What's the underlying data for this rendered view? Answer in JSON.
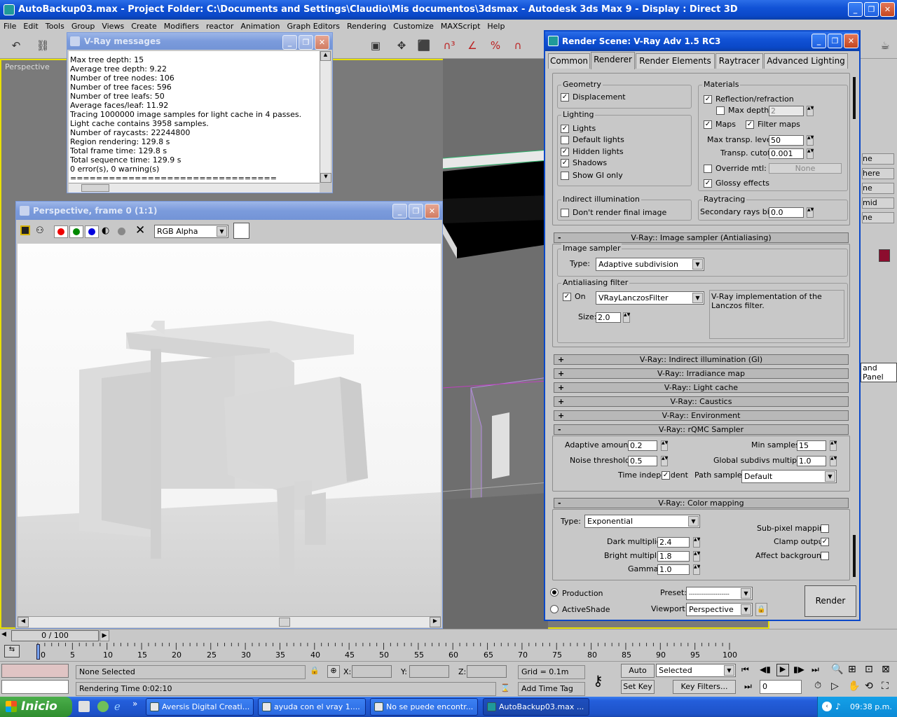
{
  "app": {
    "title": "AutoBackup03.max     - Project Folder: C:\\Documents and Settings\\Claudio\\Mis documentos\\3dsmax     - Autodesk 3ds Max 9     - Display : Direct 3D",
    "menu": [
      "File",
      "Edit",
      "Tools",
      "Group",
      "Views",
      "Create",
      "Modifiers",
      "reactor",
      "Animation",
      "Graph Editors",
      "Rendering",
      "Customize",
      "MAXScript",
      "Help"
    ],
    "viewport_label": "Perspective"
  },
  "vray_messages": {
    "title": "V-Ray messages",
    "lines": [
      "Max tree depth: 15",
      "Average tree depth: 9.22",
      "Number of tree nodes: 106",
      "Number of tree faces: 596",
      "Number of tree leafs: 50",
      "Average faces/leaf: 11.92",
      "Tracing 1000000 image samples for light cache in 4 passes.",
      "Light cache contains 3958 samples.",
      "Number of raycasts: 22244800",
      "Region rendering: 129.8 s",
      "Total frame time: 129.8 s",
      "Total sequence time: 129.9 s",
      "0 error(s), 0 warning(s)",
      "================================"
    ]
  },
  "frame_window": {
    "title": "Perspective, frame 0 (1:1)",
    "channel": "RGB Alpha"
  },
  "render_scene": {
    "title": "Render Scene: V-Ray Adv 1.5 RC3",
    "tabs": [
      "Common",
      "Renderer",
      "Render Elements",
      "Raytracer",
      "Advanced Lighting"
    ],
    "geometry": {
      "caption": "Geometry",
      "displacement": "Displacement"
    },
    "lighting": {
      "caption": "Lighting",
      "items": [
        "Lights",
        "Default lights",
        "Hidden lights",
        "Shadows",
        "Show GI only"
      ],
      "checked": [
        true,
        false,
        true,
        true,
        false
      ]
    },
    "indirect": {
      "caption": "Indirect illumination",
      "dont_render": "Don't render final image"
    },
    "materials": {
      "caption": "Materials",
      "reflection": "Reflection/refraction",
      "max_depth": "Max depth",
      "max_depth_val": "2",
      "maps": "Maps",
      "filter_maps": "Filter maps",
      "max_transp": "Max transp. levels",
      "max_transp_val": "50",
      "transp_cutoff": "Transp. cutoff",
      "transp_cutoff_val": "0.001",
      "override": "Override mtl:",
      "none": "None",
      "glossy": "Glossy effects"
    },
    "raytracing": {
      "caption": "Raytracing",
      "bias": "Secondary rays bias",
      "bias_val": "0.0"
    },
    "image_sampler_rollout": "V-Ray:: Image sampler (Antialiasing)",
    "image_sampler": {
      "caption": "Image sampler",
      "type_label": "Type:",
      "type": "Adaptive subdivision"
    },
    "aa_filter": {
      "caption": "Antialiasing filter",
      "on": "On",
      "filter": "VRayLanczosFilter",
      "desc": "V-Ray implementation of the Lanczos filter.",
      "size_label": "Size:",
      "size": "2.0"
    },
    "collapsed_rollouts": [
      "V-Ray:: Indirect illumination (GI)",
      "V-Ray:: Irradiance map",
      "V-Ray:: Light cache",
      "V-Ray:: Caustics",
      "V-Ray:: Environment"
    ],
    "rqmc_rollout": "V-Ray:: rQMC Sampler",
    "rqmc": {
      "adaptive_amount": "Adaptive amount:",
      "adaptive_amount_val": "0.2",
      "noise_threshold": "Noise threshold:",
      "noise_threshold_val": "0.5",
      "time_independent": "Time independent",
      "min_samples": "Min samples:",
      "min_samples_val": "15",
      "global_subdivs": "Global subdivs multiplier:",
      "global_subdivs_val": "1.0",
      "path_sampler": "Path sampler:",
      "path_sampler_val": "Default"
    },
    "color_mapping_rollout": "V-Ray:: Color mapping",
    "color_mapping": {
      "type_label": "Type:",
      "type": "Exponential",
      "dark": "Dark multiplier:",
      "dark_val": "2.4",
      "bright": "Bright multiplier:",
      "bright_val": "1.8",
      "gamma": "Gamma:",
      "gamma_val": "1.0",
      "subpixel": "Sub-pixel mapping",
      "clamp": "Clamp output",
      "affect_bg": "Affect background"
    },
    "production": "Production",
    "activeshade": "ActiveShade",
    "preset_label": "Preset:",
    "preset_val": "--------------------",
    "viewport_label": "Viewport:",
    "viewport_val": "Perspective",
    "render_btn": "Render"
  },
  "right_panel": {
    "items": [
      "ne",
      "here",
      "ne",
      "mid",
      "ne"
    ],
    "command_panel": "and Panel"
  },
  "timeline": {
    "frame": "0 / 100",
    "ticks": [
      "0",
      "5",
      "10",
      "15",
      "20",
      "25",
      "30",
      "35",
      "40",
      "45",
      "50",
      "55",
      "60",
      "65",
      "70",
      "75",
      "80",
      "85",
      "90",
      "95",
      "100"
    ]
  },
  "status": {
    "selection": "None Selected",
    "x": "X:",
    "y": "Y:",
    "z": "Z:",
    "grid": "Grid = 0.1m",
    "auto_key": "Auto Key",
    "set_key": "Set Key",
    "selected": "Selected",
    "key_filters": "Key Filters...",
    "rendering_time": "Rendering Time  0:02:10",
    "add_time_tag": "Add Time Tag",
    "frame_field": "0"
  },
  "taskbar": {
    "start": "Inicio",
    "items": [
      "Aversis Digital Creati...",
      "ayuda con el vray 1....",
      "No se puede encontr...",
      "AutoBackup03.max  ..."
    ],
    "clock": "09:38 p.m."
  },
  "colors": {
    "accent": "#0a48c8",
    "panel": "#c8c8c8",
    "viewport": "#7a7a7a",
    "start_green": "#3c9b3c"
  }
}
